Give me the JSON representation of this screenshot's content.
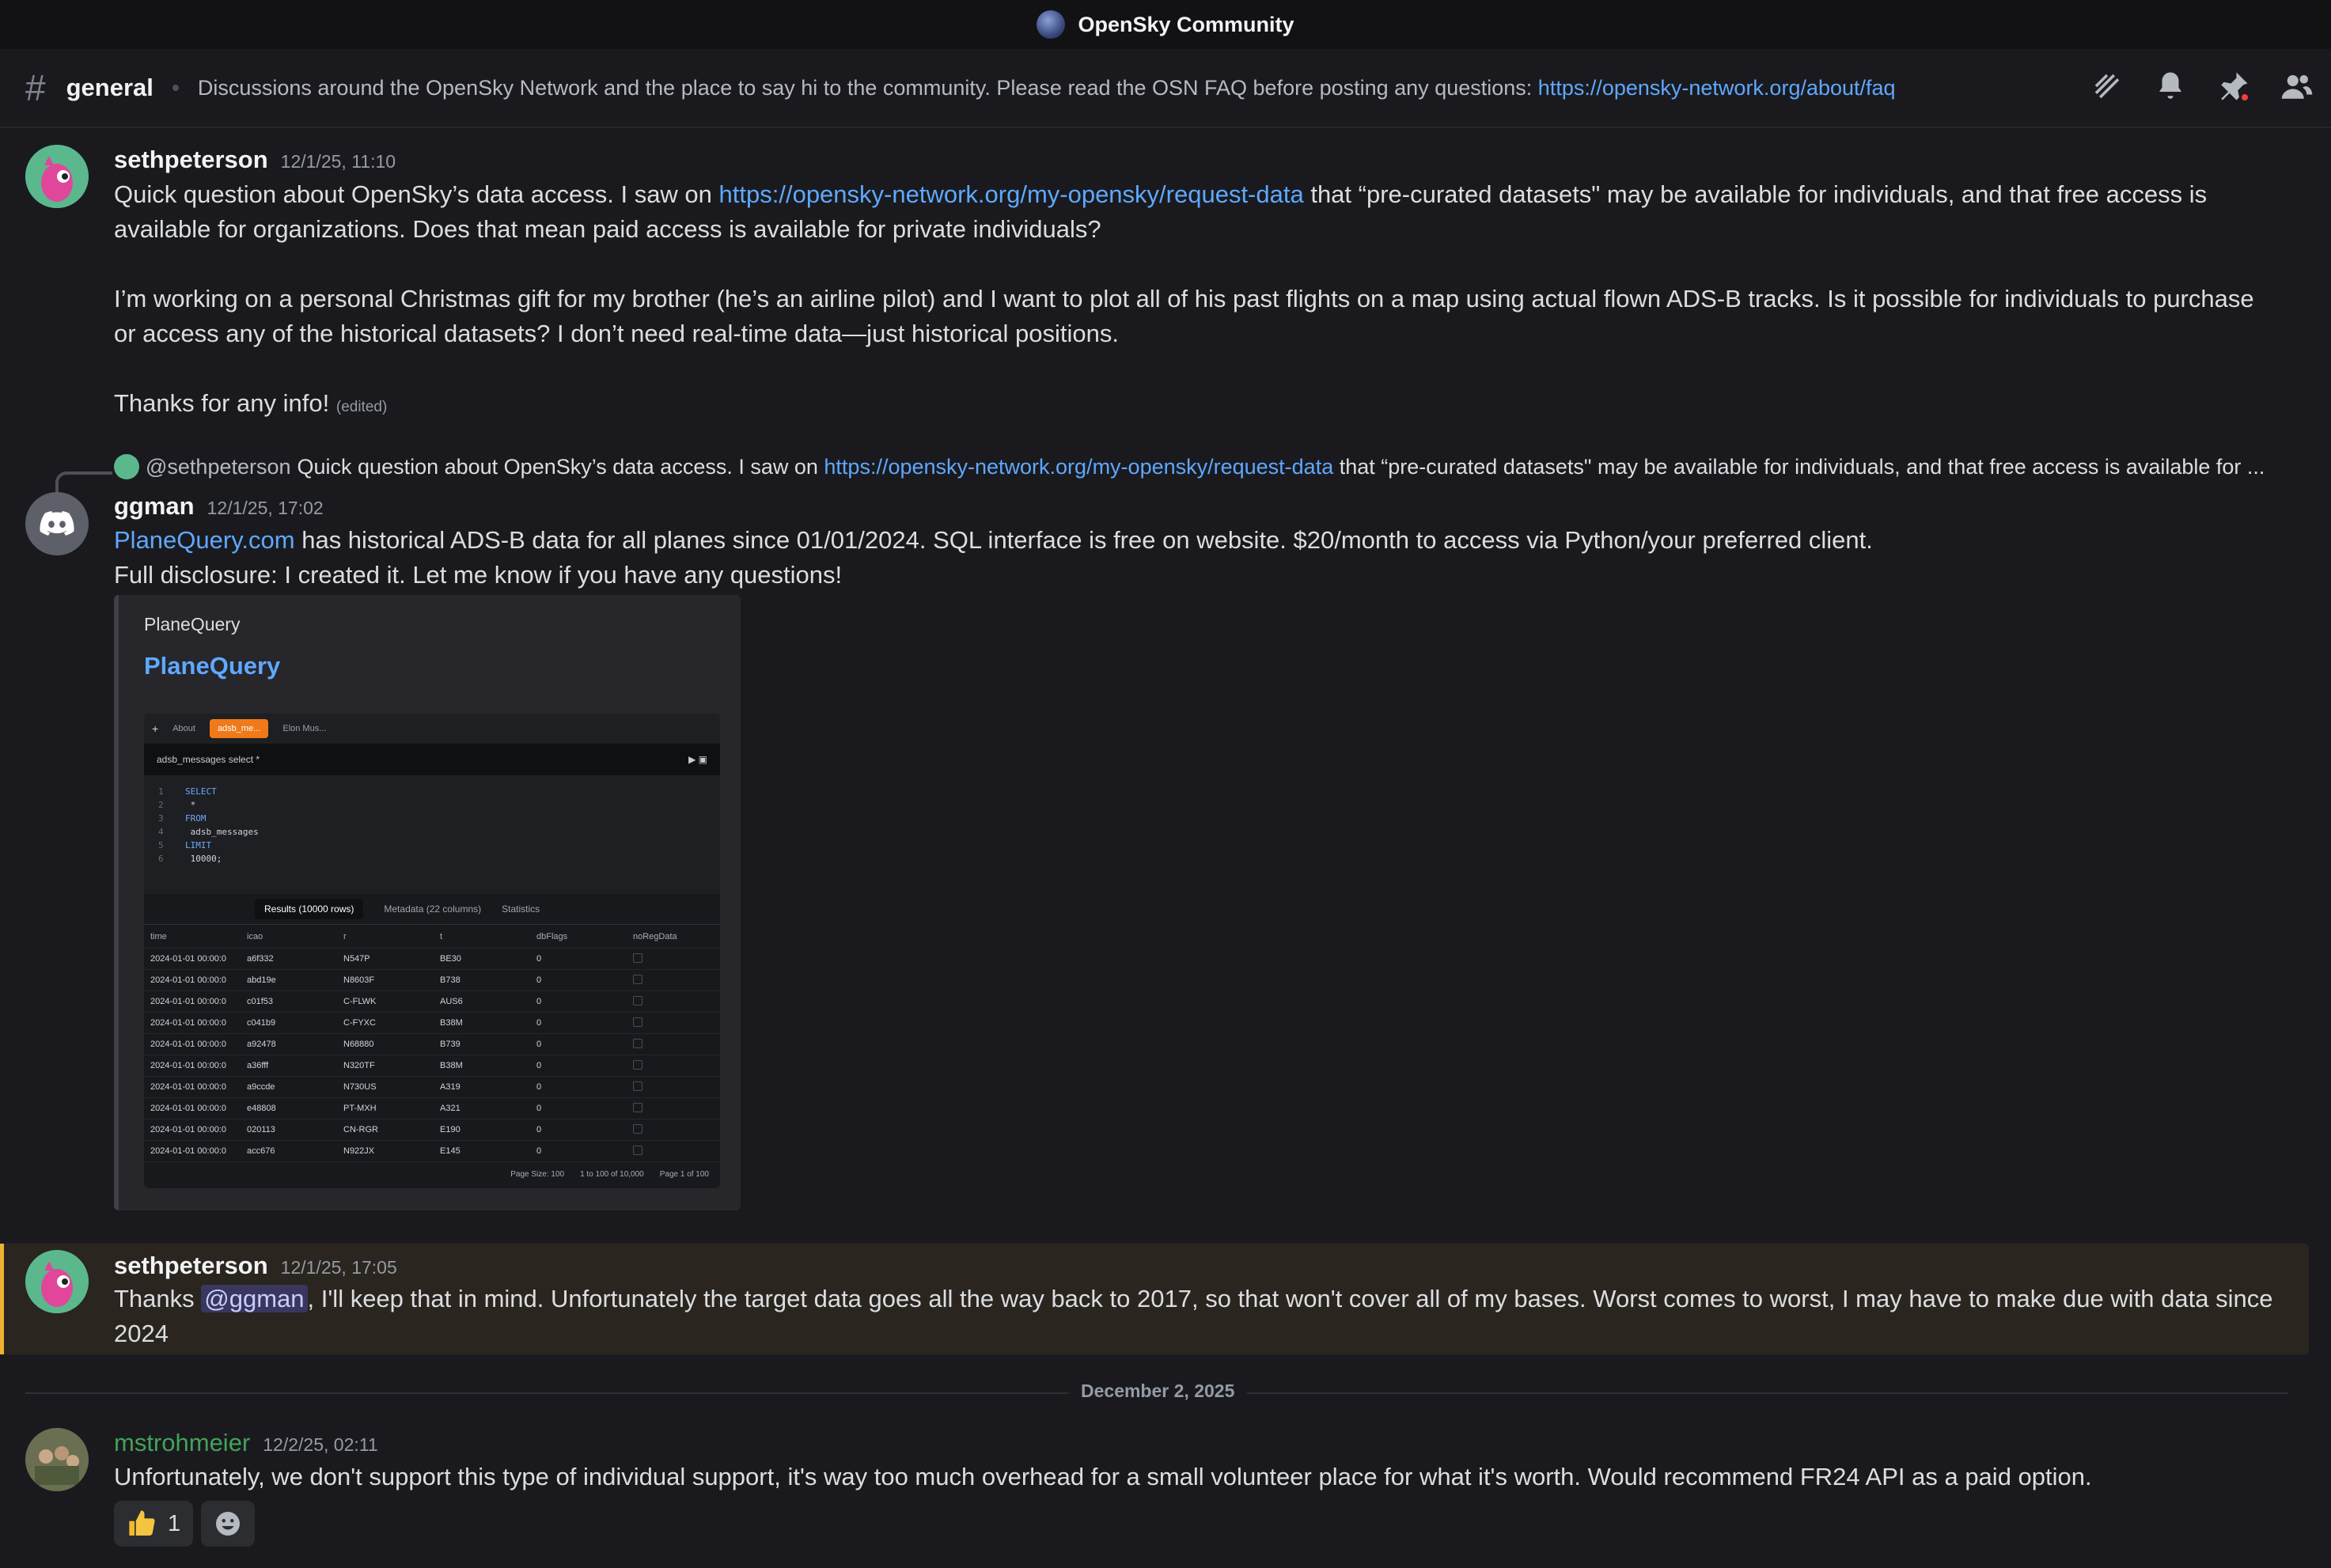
{
  "window": {
    "title": "OpenSky Community"
  },
  "channel": {
    "name": "general",
    "topic_text": "Discussions around the OpenSky Network and the place to say hi to the community. Please read the OSN FAQ before posting any questions: ",
    "topic_link": "https://opensky-network.org/about/faq"
  },
  "header_icons": [
    "threads-icon",
    "bell-icon",
    "pin-icon",
    "members-icon"
  ],
  "messages": [
    {
      "author": "sethpeterson",
      "timestamp": "12/1/25, 11:10",
      "p1_a": "Quick question about OpenSky’s data access. I saw on ",
      "p1_link": "https://opensky-network.org/my-opensky/request-data",
      "p1_b": " that “pre-curated datasets\" may be available for individuals, and that free access is available for organizations. Does that mean paid access is available for private individuals?",
      "p2": "I’m working on a personal Christmas gift for my brother (he’s an airline pilot) and I want to plot all of his past flights on a map using actual flown ADS-B tracks. Is it possible for individuals to purchase or access any of the historical datasets? I don’t need real-time data—just historical positions.",
      "p3": "Thanks for any info!",
      "edited": "(edited)"
    },
    {
      "reply_user": "@sethpeterson",
      "reply_a": "Quick question about OpenSky’s data access. I saw on ",
      "reply_link": "https://opensky-network.org/my-opensky/request-data",
      "reply_b": " that “pre-curated datasets\" may be available for individuals, and that free access is available for ...",
      "author": "ggman",
      "timestamp": "12/1/25, 17:02",
      "link": "PlaneQuery.com",
      "line1": " has historical ADS-B data for all planes since 01/01/2024. SQL interface is free on website. $20/month to access via Python/your preferred client.",
      "line2": "Full disclosure: I created it. Let me know if you have any questions!",
      "embed": {
        "provider": "PlaneQuery",
        "title": "PlaneQuery",
        "tabs": [
          "About",
          "adsb_me...",
          "Elon Mus..."
        ],
        "query_name": "adsb_messages select *",
        "code": [
          "SELECT",
          "  *",
          "FROM",
          "  adsb_messages",
          "LIMIT",
          "  10000;"
        ],
        "result_tabs": [
          "Results (10000 rows)",
          "Metadata (22 columns)",
          "Statistics"
        ],
        "columns": [
          "time",
          "icao",
          "r",
          "t",
          "dbFlags",
          "noRegData"
        ],
        "rows": [
          [
            "2024-01-01 00:00:0",
            "a6f332",
            "N547P",
            "BE30",
            "0"
          ],
          [
            "2024-01-01 00:00:0",
            "abd19e",
            "N8603F",
            "B738",
            "0"
          ],
          [
            "2024-01-01 00:00:0",
            "c01f53",
            "C-FLWK",
            "AUS6",
            "0"
          ],
          [
            "2024-01-01 00:00:0",
            "c041b9",
            "C-FYXC",
            "B38M",
            "0"
          ],
          [
            "2024-01-01 00:00:0",
            "a92478",
            "N68880",
            "B739",
            "0"
          ],
          [
            "2024-01-01 00:00:0",
            "a36fff",
            "N320TF",
            "B38M",
            "0"
          ],
          [
            "2024-01-01 00:00:0",
            "a9ccde",
            "N730US",
            "A319",
            "0"
          ],
          [
            "2024-01-01 00:00:0",
            "e48808",
            "PT-MXH",
            "A321",
            "0"
          ],
          [
            "2024-01-01 00:00:0",
            "020113",
            "CN-RGR",
            "E190",
            "0"
          ],
          [
            "2024-01-01 00:00:0",
            "acc676",
            "N922JX",
            "E145",
            "0"
          ]
        ],
        "page_size_label": "Page Size:",
        "page_size": "100",
        "range": "1 to 100 of 10,000",
        "page": "Page 1 of 100"
      }
    },
    {
      "author": "sethpeterson",
      "timestamp": "12/1/25, 17:05",
      "a": "Thanks ",
      "mention": "@ggman",
      "b": ", I'll keep that in mind. Unfortunately the target data goes all the way back to 2017, so that won't cover all of my bases. Worst comes to worst, I may have to make due with data since 2024"
    },
    {
      "author": "mstrohmeier",
      "timestamp": "12/2/25, 02:11",
      "text": "Unfortunately, we don't support this type of individual support, it's way too much overhead for a small volunteer place for what it's worth. Would recommend FR24 API as a paid option.",
      "reaction_count": "1"
    }
  ],
  "date_divider": "December 2, 2025",
  "colors": {
    "accent_link": "#5fa8ff",
    "highlight_bar": "#f0b232",
    "mst_name": "#43a25a"
  }
}
